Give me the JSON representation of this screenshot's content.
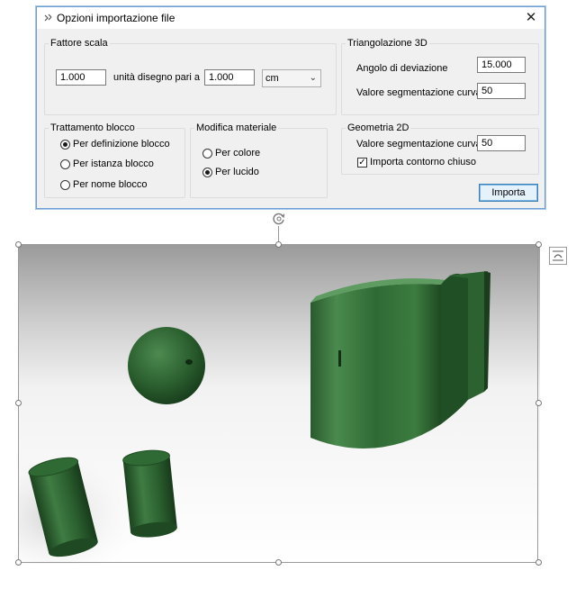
{
  "dialog": {
    "title": "Opzioni importazione file",
    "close_glyph": "✕"
  },
  "scale": {
    "legend": "Fattore scala",
    "value1": "1.000",
    "label": "unità disegno pari a",
    "value2": "1.000",
    "unit": "cm"
  },
  "triangulation": {
    "legend": "Triangolazione 3D",
    "angle_label": "Angolo di deviazione",
    "angle_value": "15.000",
    "curve_label": "Valore segmentazione curva",
    "curve_value": "50"
  },
  "block": {
    "legend": "Trattamento blocco",
    "options": [
      "Per definizione blocco",
      "Per istanza blocco",
      "Per nome blocco"
    ],
    "selected": 0
  },
  "material": {
    "legend": "Modifica materiale",
    "options": [
      "Per colore",
      "Per lucido"
    ],
    "selected": 1
  },
  "geometry2d": {
    "legend": "Geometria 2D",
    "curve_label": "Valore segmentazione curva",
    "curve_value": "50",
    "closed_contour_label": "Importa contorno chiuso",
    "closed_contour_checked": true
  },
  "import_button": "Importa",
  "icons": {
    "app": "import-options-icon",
    "rotate": "rotate-handle-icon",
    "layout": "layout-options-icon"
  },
  "colors": {
    "object_green": "#2f6a34",
    "selection_blue": "#6d9fd4"
  }
}
